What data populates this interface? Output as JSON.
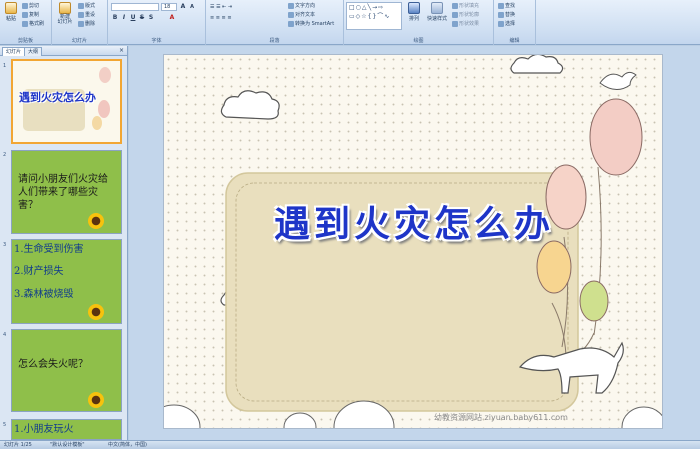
{
  "ribbon": {
    "groups": {
      "clipboard": "剪贴板",
      "slides": "幻灯片",
      "font": "字体",
      "paragraph": "段落",
      "drawing": "绘图",
      "editing": "编辑"
    },
    "clipboard": {
      "paste": "粘贴",
      "cut": "剪切",
      "copy": "复制",
      "format_painter": "格式刷"
    },
    "slides": {
      "new_slide": "新建\n幻灯片",
      "layout": "版式",
      "reset": "重设",
      "delete": "删除"
    },
    "paragraph": {
      "text_direction": "文字方向",
      "align_text": "对齐文本",
      "smartart": "转换为 SmartArt"
    },
    "drawing": {
      "arrange": "排列",
      "quick_styles": "快速样式",
      "shape_fill": "形状填充",
      "shape_outline": "形状轮廓",
      "shape_effects": "形状效果"
    },
    "editing": {
      "find": "查找",
      "replace": "替换",
      "select": "选择"
    },
    "font_size": "18"
  },
  "panel": {
    "tabs": [
      "幻灯片",
      "大纲"
    ],
    "close": "×",
    "thumbs": [
      {
        "num": "1",
        "title": "遇到火灾怎么办"
      },
      {
        "num": "2",
        "text": "请问小朋友们火灾给人们带来了哪些灾害？"
      },
      {
        "num": "3",
        "items": [
          "1.生命受到伤害",
          "2.财产损失",
          "3.森林被烧毁"
        ]
      },
      {
        "num": "4",
        "text": "怎么会失火呢？"
      },
      {
        "num": "5",
        "text": "1.小朋友玩火"
      }
    ]
  },
  "slide": {
    "title": "遇到火灾怎么办",
    "watermark": "幼教资源网站  ziyuan.baby611.com"
  },
  "status": {
    "slide_info": "幻灯片 1/25",
    "theme": "\"默认设计模板\"",
    "language": "中文(简体，中国)"
  }
}
